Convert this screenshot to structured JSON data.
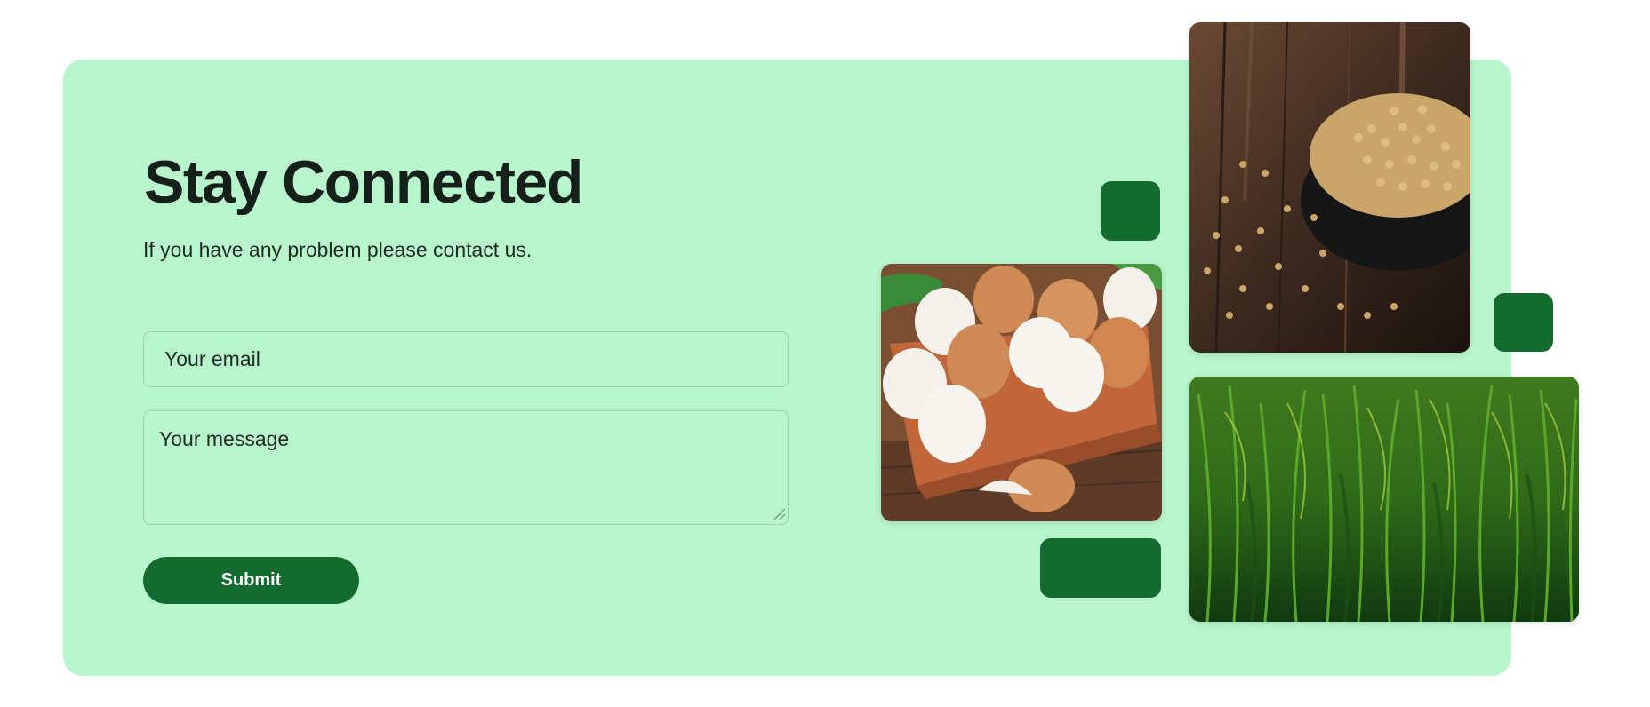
{
  "contact": {
    "title": "Stay Connected",
    "subtitle": "If you have any problem please contact us.",
    "email_placeholder": "Your email",
    "message_placeholder": "Your message",
    "submit_label": "Submit"
  },
  "colors": {
    "panel_background": "#b8f5cc",
    "accent_green": "#146b2f",
    "title_text": "#16201b",
    "field_border": "#9fd3b2"
  },
  "gallery": {
    "images": [
      {
        "subject": "soybeans-bowl-photo"
      },
      {
        "subject": "eggs-carton-photo"
      },
      {
        "subject": "rice-field-photo"
      }
    ]
  }
}
